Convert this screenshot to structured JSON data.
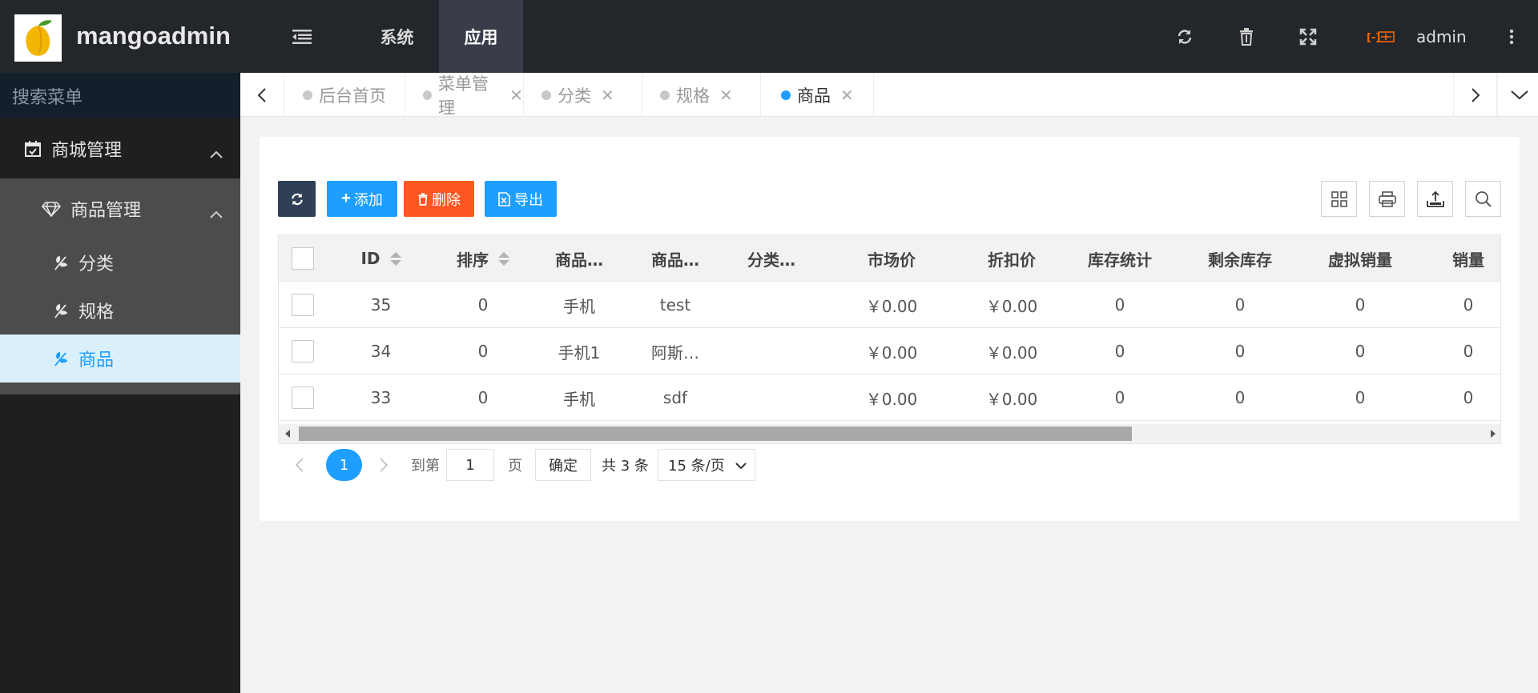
{
  "header": {
    "brand": "mangoadmin",
    "nav": [
      {
        "label": "系统"
      },
      {
        "label": "应用"
      }
    ],
    "user": "admin",
    "accent": "#23262b"
  },
  "sidebar": {
    "search_placeholder": "搜索菜单",
    "group": "商城管理",
    "sub": "商品管理",
    "items": [
      {
        "label": "分类"
      },
      {
        "label": "规格"
      },
      {
        "label": "商品"
      }
    ]
  },
  "tabs": [
    {
      "label": "后台首页"
    },
    {
      "label": "菜单管理"
    },
    {
      "label": "分类"
    },
    {
      "label": "规格"
    },
    {
      "label": "商品"
    }
  ],
  "toolbar": {
    "add_label": "添加",
    "delete_label": "删除",
    "export_label": "导出",
    "colors": {
      "refresh": "#2f4056",
      "add": "#1e9fff",
      "delete": "#ff5722",
      "export": "#1e9fff"
    }
  },
  "table": {
    "columns": [
      "ID",
      "排序",
      "商品…",
      "商品…",
      "分类…",
      "市场价",
      "折扣价",
      "库存统计",
      "剩余库存",
      "虚拟销量",
      "销量"
    ],
    "rows": [
      [
        "35",
        "0",
        "手机",
        "test",
        "",
        "￥0.00",
        "￥0.00",
        "0",
        "0",
        "0",
        "0"
      ],
      [
        "34",
        "0",
        "手机1",
        "阿斯…",
        "",
        "￥0.00",
        "￥0.00",
        "0",
        "0",
        "0",
        "0"
      ],
      [
        "33",
        "0",
        "手机",
        "sdf",
        "",
        "￥0.00",
        "￥0.00",
        "0",
        "0",
        "0",
        "0"
      ]
    ]
  },
  "pager": {
    "current": "1",
    "goto_label": "到第",
    "goto_value": "1",
    "page_label": "页",
    "confirm": "确定",
    "total": "共 3 条",
    "page_size": "15 条/页"
  }
}
